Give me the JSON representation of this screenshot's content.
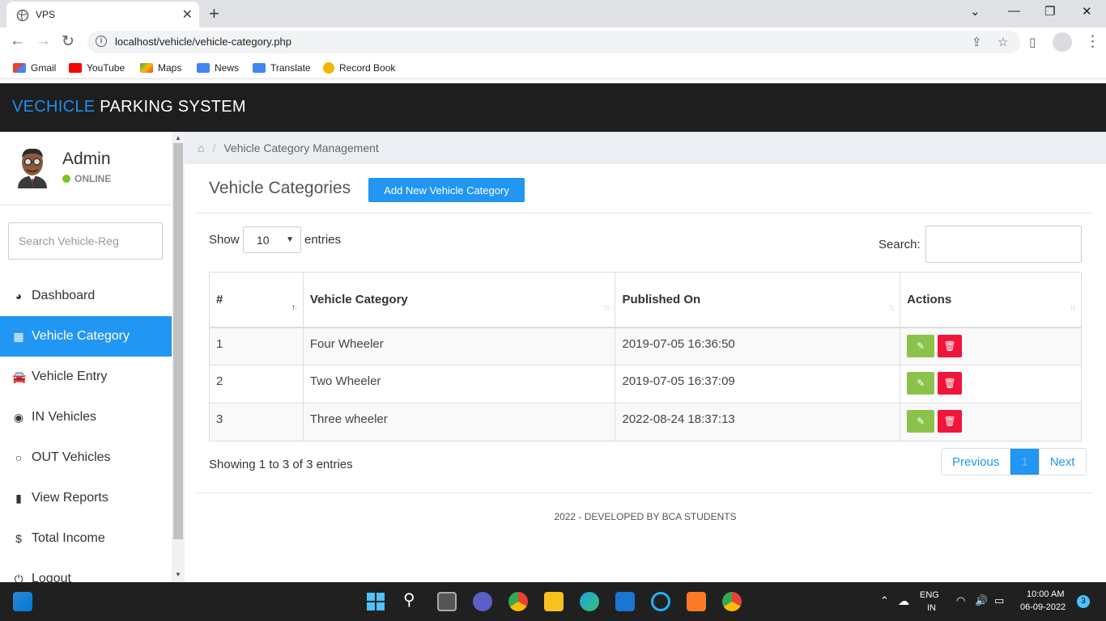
{
  "browser": {
    "tab_title": "VPS",
    "url": "localhost/vehicle/vehicle-category.php",
    "bookmarks": [
      "Gmail",
      "YouTube",
      "Maps",
      "News",
      "Translate",
      "Record Book"
    ]
  },
  "app": {
    "brand_part1": "VECHICLE",
    "brand_part2": " PARKING SYSTEM"
  },
  "sidebar": {
    "user_name": "Admin",
    "user_status": "ONLINE",
    "search_placeholder": "Search Vehicle-Reg",
    "items": [
      {
        "label": "Dashboard",
        "icon": "dashboard-icon"
      },
      {
        "label": "Vehicle Category",
        "icon": "grid-icon"
      },
      {
        "label": "Vehicle Entry",
        "icon": "car-icon"
      },
      {
        "label": "IN Vehicles",
        "icon": "toggle-on-icon"
      },
      {
        "label": "OUT Vehicles",
        "icon": "toggle-off-icon"
      },
      {
        "label": "View Reports",
        "icon": "file-icon"
      },
      {
        "label": "Total Income",
        "icon": "dollar-icon"
      },
      {
        "label": "Logout",
        "icon": "power-icon"
      }
    ]
  },
  "breadcrumb": {
    "current": "Vehicle Category Management"
  },
  "main": {
    "title": "Vehicle Categories",
    "add_button": "Add New Vehicle Category",
    "show_label": "Show",
    "show_value": "10",
    "entries_label": "entries",
    "search_label": "Search:",
    "columns": [
      "#",
      "Vehicle Category",
      "Published On",
      "Actions"
    ],
    "rows": [
      {
        "num": "1",
        "category": "Four Wheeler",
        "published": "2019-07-05 16:36:50"
      },
      {
        "num": "2",
        "category": "Two Wheeler",
        "published": "2019-07-05 16:37:09"
      },
      {
        "num": "3",
        "category": "Three wheeler",
        "published": "2022-08-24 18:37:13"
      }
    ],
    "info": "Showing 1 to 3 of 3 entries",
    "pager": {
      "previous": "Previous",
      "page": "1",
      "next": "Next"
    },
    "footer": "2022 - DEVELOPED BY BCA STUDENTS"
  },
  "taskbar": {
    "lang1": "ENG",
    "lang2": "IN",
    "time": "10:00 AM",
    "date": "06-09-2022",
    "notif_count": "3"
  },
  "colors": {
    "accent": "#2196f3",
    "edit": "#8bc34a",
    "delete": "#f0153a",
    "header_bg": "#1e1e1e"
  }
}
